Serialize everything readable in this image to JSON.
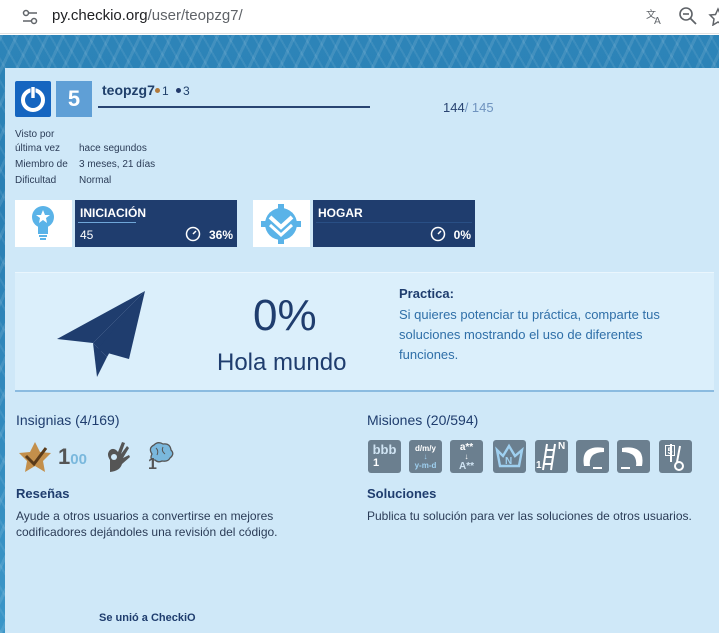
{
  "browser": {
    "url_host": "py.checkio.org",
    "url_path": "/user/teopzg7/"
  },
  "profile": {
    "level": "5",
    "username": "teopzg7",
    "medal_bronze_count": "1",
    "medal_navy_count": "3",
    "score_current": "144",
    "score_total": "/ 145",
    "info": [
      {
        "label_line1": "Visto por",
        "label_line2": "última vez",
        "value": "hace segundos"
      },
      {
        "label": "Miembro de",
        "value": "3 meses, 21 días"
      },
      {
        "label": "Dificultad",
        "value": "Normal"
      }
    ]
  },
  "tracks": [
    {
      "title": "INICIACIÓN",
      "count": "45",
      "percent": "36%",
      "progress_fraction": 0.36
    },
    {
      "title": "HOGAR",
      "count": "",
      "percent": "0%",
      "progress_fraction": 0
    }
  ],
  "practice": {
    "percent": "0%",
    "name": "Hola mundo",
    "heading": "Practica:",
    "text": "Si quieres potenciar tu práctica, comparte tus soluciones mostrando el uso de diferentes funciones."
  },
  "badges": {
    "title": "Insignias (4/169)",
    "items": [
      {
        "icon": "star-checkmark-icon"
      },
      {
        "icon": "hundred-icon",
        "text_main": "1",
        "text_tail": "00"
      },
      {
        "icon": "ok-hand-icon"
      },
      {
        "icon": "brain-icon",
        "count": "1"
      }
    ]
  },
  "missions": {
    "title": "Misiones (20/594)",
    "items": [
      {
        "icon": "bbb-mission-icon",
        "top": "bbb",
        "bottom": "1"
      },
      {
        "icon": "date-format-mission-icon",
        "top": "d/m/y",
        "bottom": "y-m-d"
      },
      {
        "icon": "uppercase-mission-icon",
        "top": "a**",
        "bottom": "A**"
      },
      {
        "icon": "crown-mission-icon"
      },
      {
        "icon": "ladder-mission-icon",
        "top": "N",
        "bottom": "1"
      },
      {
        "icon": "snake-mission-icon"
      },
      {
        "icon": "snake-reverse-mission-icon"
      },
      {
        "icon": "thermometer-mission-icon",
        "top": "5"
      }
    ]
  },
  "reviews": {
    "title": "Reseñas",
    "text": "Ayude a otros usuarios a convertirse en mejores codificadores dejándoles una revisión del código."
  },
  "solutions": {
    "title": "Soluciones",
    "text": "Publica tu solución para ver las soluciones de otros usuarios."
  },
  "footer": {
    "joined": "Se unió a CheckiO"
  },
  "colors": {
    "navy": "#1f3d6e",
    "panel": "#cfe8f8",
    "accent_blue": "#1565c0"
  }
}
